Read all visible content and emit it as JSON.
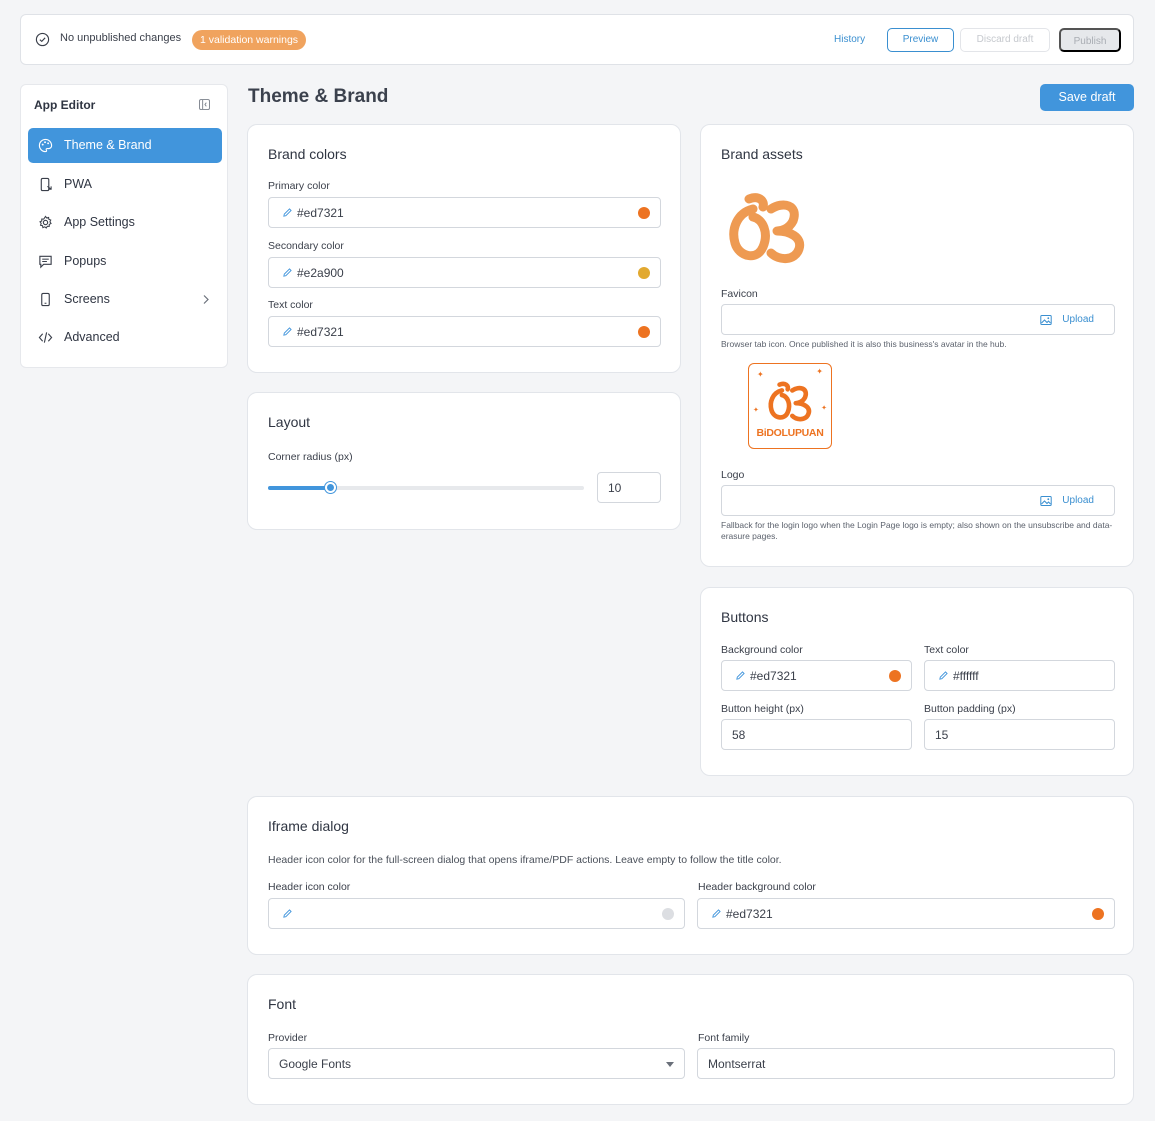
{
  "topbar": {
    "status_text": "No unpublished changes",
    "warning_badge": "1 validation warnings",
    "history_label": "History",
    "preview_label": "Preview",
    "discard_label": "Discard draft",
    "publish_label": "Publish"
  },
  "sidebar": {
    "title": "App Editor",
    "items": [
      {
        "label": "Theme & Brand",
        "icon": "palette-icon",
        "active": true
      },
      {
        "label": "PWA",
        "icon": "device-icon"
      },
      {
        "label": "App Settings",
        "icon": "gear-icon"
      },
      {
        "label": "Popups",
        "icon": "popup-icon"
      },
      {
        "label": "Screens",
        "icon": "phone-icon",
        "has_chevron": true
      },
      {
        "label": "Advanced",
        "icon": "code-icon"
      }
    ]
  },
  "page": {
    "title": "Theme & Brand",
    "save_label": "Save draft"
  },
  "brand_colors": {
    "title": "Brand colors",
    "primary_label": "Primary color",
    "primary_value": "#ed7321",
    "secondary_label": "Secondary color",
    "secondary_value": "#e2a900",
    "text_label": "Text color",
    "text_value": "#ed7321"
  },
  "layout": {
    "title": "Layout",
    "radius_label": "Corner radius (px)",
    "radius_value": "10",
    "radius_fraction": 0.2
  },
  "brand_assets": {
    "title": "Brand assets",
    "favicon_label": "Favicon",
    "favicon_upload": "Upload",
    "favicon_help": "Browser tab icon. Once published it is also this business's avatar in the hub.",
    "logo_label": "Logo",
    "logo_upload": "Upload",
    "logo_help": "Fallback for the login logo when the Login Page logo is empty; also shown on the unsubscribe and data-erasure pages.",
    "logo_text": "BiDOLUPUAN"
  },
  "buttons": {
    "title": "Buttons",
    "bg_label": "Background color",
    "bg_value": "#ed7321",
    "text_label": "Text color",
    "text_value": "#ffffff",
    "height_label": "Button height (px)",
    "height_value": "58",
    "padding_label": "Button padding (px)",
    "padding_value": "15"
  },
  "iframe": {
    "title": "Iframe dialog",
    "description": "Header icon color for the full-screen dialog that opens iframe/PDF actions. Leave empty to follow the title color.",
    "icon_color_label": "Header icon color",
    "icon_color_value": "",
    "bg_color_label": "Header background color",
    "bg_color_value": "#ed7321"
  },
  "font": {
    "title": "Font",
    "provider_label": "Provider",
    "provider_value": "Google Fonts",
    "family_label": "Font family",
    "family_value": "Montserrat"
  },
  "colors": {
    "accent": "#4195dc",
    "brand_orange": "#ed7321",
    "brand_yellow": "#e2a900",
    "warning": "#f0a35e",
    "empty_swatch": "#dcdee2"
  }
}
